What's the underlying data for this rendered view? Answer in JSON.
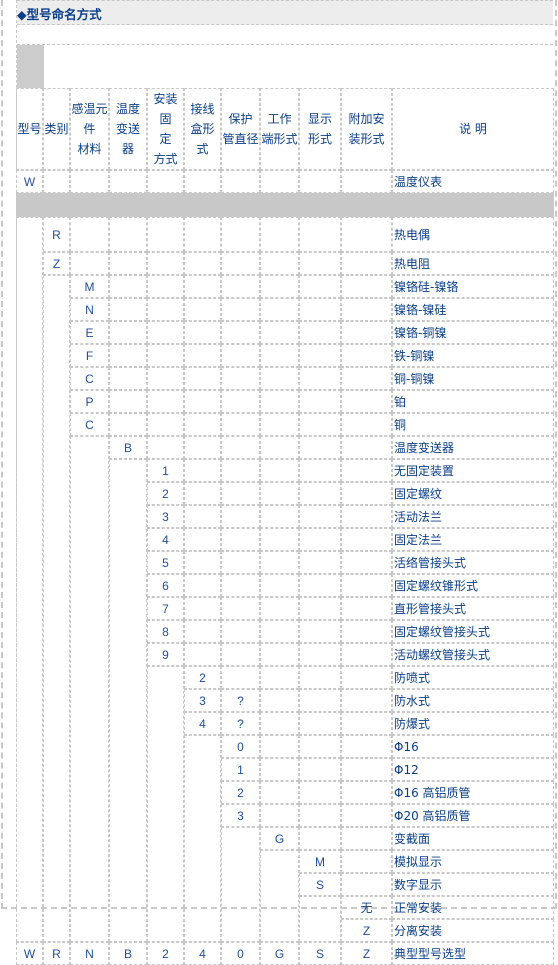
{
  "section_title": "◆型号命名方式",
  "headers": [
    "型号",
    "类别",
    "感温元件材料",
    "温度变送器",
    "安装固定方式",
    "接线盒形式",
    "保护管直径",
    "工作端形式",
    "显示形式",
    "附加安装形式",
    "说 明"
  ],
  "header_lines": {
    "model": [
      "型号"
    ],
    "category": [
      "类别"
    ],
    "element": [
      "感温元",
      "件",
      "材料"
    ],
    "transmitter": [
      "温度",
      "变送",
      "器"
    ],
    "mounting": [
      "安装固",
      "定",
      "方式"
    ],
    "junction_box": [
      "接线",
      "盒形式"
    ],
    "tube_diameter": [
      "保护",
      "管直径"
    ],
    "working_end": [
      "工作",
      "端形式"
    ],
    "display": [
      "显示",
      "形式"
    ],
    "extra_install": [
      "附加安",
      "装形式"
    ],
    "description": [
      "说 明"
    ]
  },
  "rows": {
    "model": {
      "code": "W",
      "desc": "温度仪表"
    },
    "category": [
      {
        "code": "R",
        "desc": "热电偶"
      },
      {
        "code": "Z",
        "desc": "热电阻"
      }
    ],
    "element": [
      {
        "code": "M",
        "desc": "镍铬硅-镍铬"
      },
      {
        "code": "N",
        "desc": "镍铬-镍硅"
      },
      {
        "code": "E",
        "desc": "镍铬-铜镍"
      },
      {
        "code": "F",
        "desc": "铁-铜镍"
      },
      {
        "code": "C",
        "desc": "铜-铜镍"
      },
      {
        "code": "P",
        "desc": "铂"
      },
      {
        "code": "C",
        "desc": "铜"
      }
    ],
    "transmitter": [
      {
        "code": "B",
        "desc": "温度变送器"
      }
    ],
    "mounting": [
      {
        "code": "1",
        "desc": "无固定装置"
      },
      {
        "code": "2",
        "desc": "固定螺纹"
      },
      {
        "code": "3",
        "desc": "活动法兰"
      },
      {
        "code": "4",
        "desc": "固定法兰"
      },
      {
        "code": "5",
        "desc": "活络管接头式"
      },
      {
        "code": "6",
        "desc": "固定螺纹锥形式"
      },
      {
        "code": "7",
        "desc": "直形管接头式"
      },
      {
        "code": "8",
        "desc": "固定螺纹管接头式"
      },
      {
        "code": "9",
        "desc": "活动螺纹管接头式"
      }
    ],
    "junction_box": [
      {
        "code": "2",
        "tube": "",
        "desc": "防喷式"
      },
      {
        "code": "3",
        "tube": "?",
        "desc": "防水式"
      },
      {
        "code": "4",
        "tube": "?",
        "desc": "防爆式"
      }
    ],
    "tube_diameter": [
      {
        "code": "0",
        "desc": "Φ16"
      },
      {
        "code": "1",
        "desc": "Φ12"
      },
      {
        "code": "2",
        "desc": "Φ16 高铝质管"
      },
      {
        "code": "3",
        "desc": "Φ20 高铝质管"
      }
    ],
    "working_end": [
      {
        "code": "G",
        "desc": "变截面"
      }
    ],
    "display": [
      {
        "code": "M",
        "desc": "模拟显示"
      },
      {
        "code": "S",
        "desc": "数字显示"
      }
    ],
    "extra_install": [
      {
        "code": "无",
        "desc": "正常安装"
      },
      {
        "code": "Z",
        "desc": "分离安装"
      }
    ],
    "example": {
      "codes": [
        "W",
        "R",
        "N",
        "B",
        "2",
        "4",
        "0",
        "G",
        "S",
        "Z"
      ],
      "desc": "典型型号选型"
    }
  }
}
